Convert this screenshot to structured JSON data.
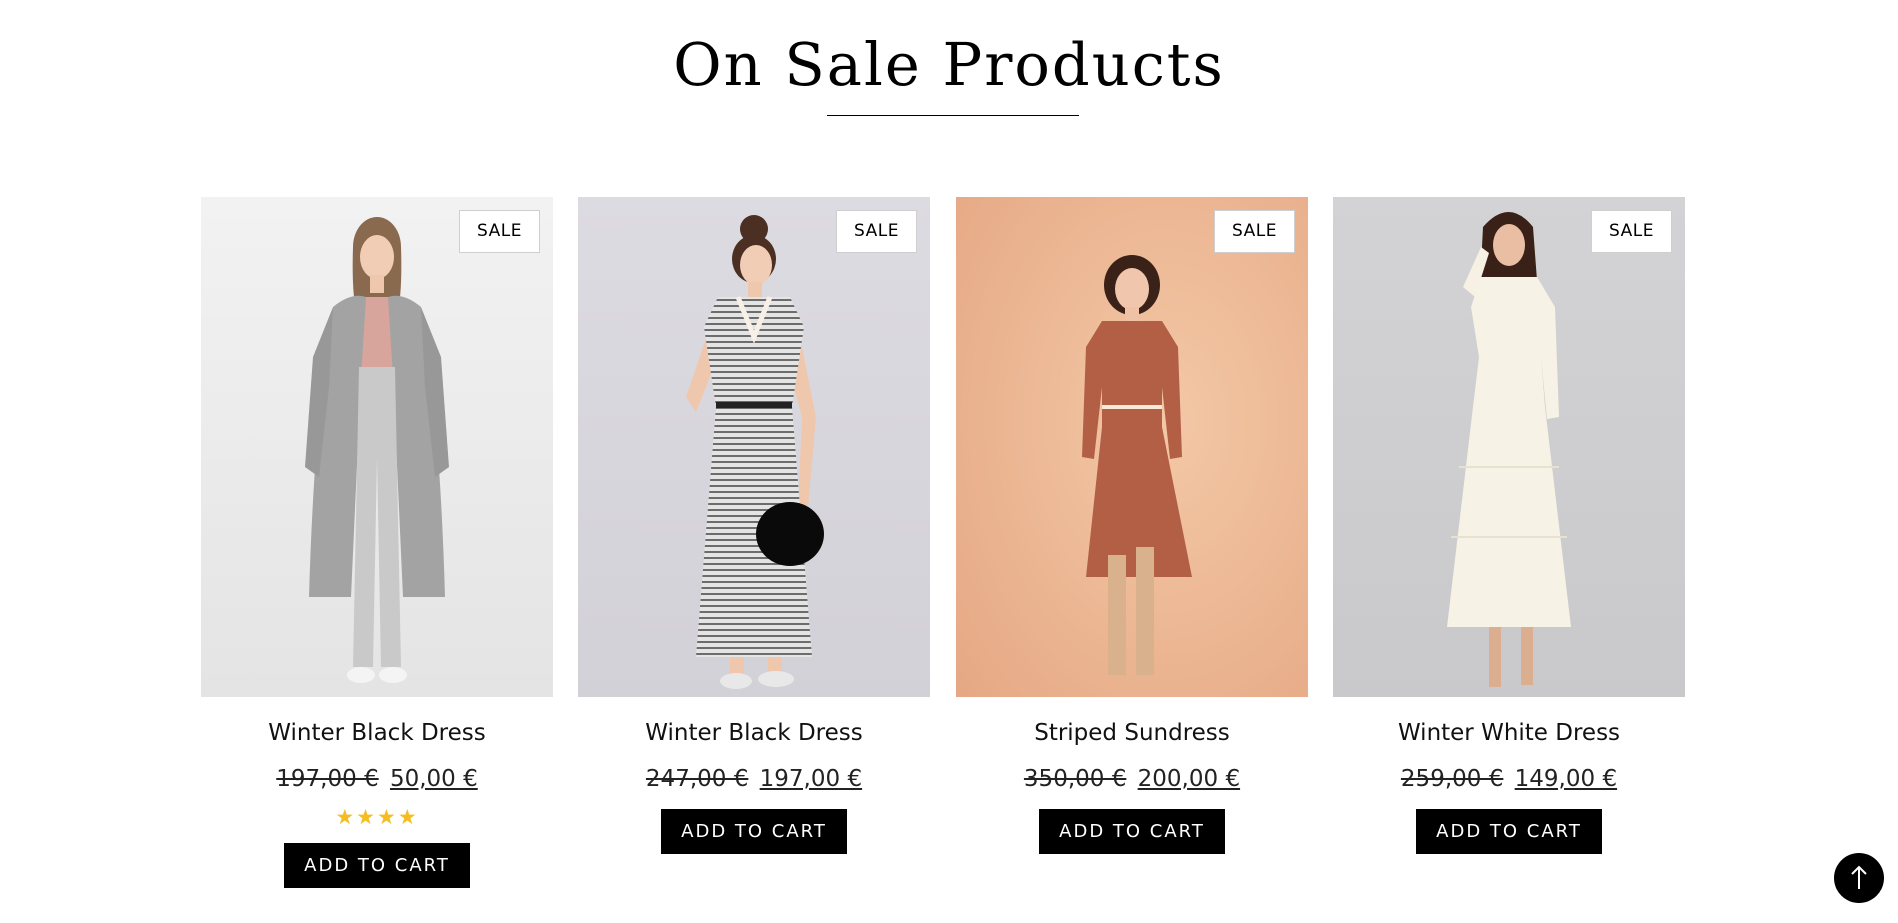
{
  "section": {
    "title": "On Sale Products"
  },
  "products": [
    {
      "name": "Winter Black Dress",
      "badge": "SALE",
      "price_old": "197,00 €",
      "price_new": "50,00 €",
      "rating": 4,
      "rating_stars": "★★★★",
      "button": "ADD TO CART",
      "image_bg": "#eeeeee"
    },
    {
      "name": "Winter Black Dress",
      "badge": "SALE",
      "price_old": "247,00 €",
      "price_new": "197,00 €",
      "button": "ADD TO CART",
      "image_bg": "#d9d8de"
    },
    {
      "name": "Striped Sundress",
      "badge": "SALE",
      "price_old": "350,00 €",
      "price_new": "200,00 €",
      "button": "ADD TO CART",
      "image_bg": "#eab48f"
    },
    {
      "name": "Winter White Dress",
      "badge": "SALE",
      "price_old": "259,00 €",
      "price_new": "149,00 €",
      "button": "ADD TO CART",
      "image_bg": "#cfcfd1"
    }
  ],
  "scroll_top": {
    "icon": "arrow-up-icon",
    "glyph": "↑"
  },
  "colors": {
    "button_bg": "#000000",
    "star": "#f5bd1f"
  }
}
